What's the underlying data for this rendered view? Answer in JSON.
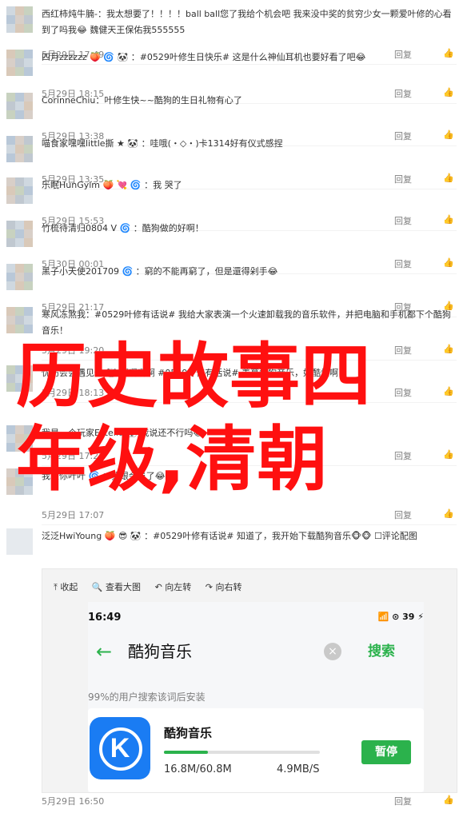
{
  "comments": [
    {
      "text": "西红柿炖牛腩-：我太想要了！！！！ball ball您了我给个机会吧 我来没中奖的贫穷少女一颗爱叶修的心看到了吗我😂 魏健天王保佑我555555",
      "time": "5月29日 17:49",
      "reply": "回复",
      "likes": ""
    },
    {
      "text": "四月zzzzzz 🍑 🌀 🐼 ：#0529叶修生日快乐# 这是什么神仙耳机也要好看了吧😂",
      "time": "5月29日 18:15",
      "reply": "回复",
      "likes": ""
    },
    {
      "text": "CorinneChiu：叶修生快~~酷狗的生日礼物有心了",
      "time": "5月29日 13:38",
      "reply": "回复",
      "likes": ""
    },
    {
      "text": "喵食家嘿嘿little撕 ★ 🐼 ：哇哦(・◇・)卡1314好有仪式感捏",
      "time": "5月29日 13:35",
      "reply": "回复",
      "likes": ""
    },
    {
      "text": "乐眠HunGylm 🍑 💘 🌀 ：我 哭了",
      "time": "5月29日 15:53",
      "reply": "回复",
      "likes": ""
    },
    {
      "text": "竹梳待清归0804 V 🌀 ：酷狗做的好啊！",
      "time": "5月30日 00:01",
      "reply": "回复",
      "likes": ""
    },
    {
      "text": "黑子小天使201709 🌀 ：窮的不能再窮了，但是還得剁手😂",
      "time": "5月29日 21:17",
      "reply": "回复",
      "likes": ""
    },
    {
      "text": "寒风冻煞我：#0529叶修有话说# 我给大家表演一个火速卸载我的音乐软件，并把电脑和手机都下个酷狗音乐！",
      "time": "5月29日 19:20",
      "reply": "回复",
      "likes": ""
    },
    {
      "text": "忧伤会会遇见你 🐼 啊啊啊啊 #0529叶修有话说# 羡慕酷狗音乐，好酷炫啊",
      "time": "5月29日 18:13",
      "reply": "回复",
      "likes": ""
    },
    {
      "text": "我是一个玩家Estelle 🐼 我说还不行吗😂",
      "time": "5月29日 17:28",
      "reply": "回复",
      "likes": ""
    },
    {
      "text": "我是你叶叶 🌀 ：我跟会员了😂",
      "time": "5月29日 17:07",
      "reply": "回复",
      "likes": ""
    }
  ],
  "last_comment": {
    "text": "泛泛HwiYoung 🍑 😎 🐼 ：#0529叶修有话说# 知道了，我开始下载酷狗音乐🐵🐵 ☐评论配图",
    "time": "5月29日 16:50",
    "reply": "回复"
  },
  "overlay": {
    "line1": "历史故事四",
    "line2": "年级,清朝"
  },
  "image_box": {
    "tools": [
      "⤒ 收起",
      "🔍 查看大图",
      "↶ 向左转",
      "↷ 向右转"
    ],
    "status_time": "16:49",
    "status_right": "📶 ⊙ 39 ⚡",
    "search_query": "酷狗音乐",
    "search_button": "搜索",
    "hint": "99%的用户搜索该词后安装",
    "app_name": "酷狗音乐",
    "app_letter": "K",
    "download_progress": 0.28,
    "sizes": "16.8M/60.8M",
    "speed": "4.9MB/S",
    "pause_button": "暂停"
  },
  "colors": {
    "accent": "#2bb24c",
    "overlay": "#ff1010",
    "username": "#eb7350"
  }
}
